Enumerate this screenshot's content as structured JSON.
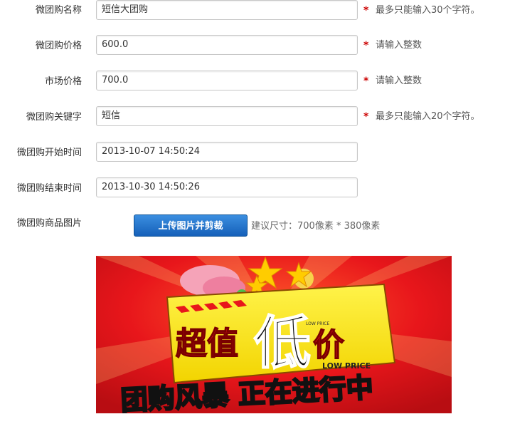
{
  "form": {
    "name": {
      "label": "微团购名称",
      "value": "短信大团购",
      "required": "*",
      "hint": "最多只能输入30个字符。"
    },
    "price": {
      "label": "微团购价格",
      "value": "600.0",
      "required": "*",
      "hint": "请输入整数"
    },
    "market_price": {
      "label": "市场价格",
      "value": "700.0",
      "required": "*",
      "hint": "请输入整数"
    },
    "keyword": {
      "label": "微团购关键字",
      "value": "短信",
      "required": "*",
      "hint": "最多只能输入20个字符。"
    },
    "start_time": {
      "label": "微团购开始时间",
      "value": "2013-10-07 14:50:24"
    },
    "end_time": {
      "label": "微团购结束时间",
      "value": "2013-10-30 14:50:26"
    },
    "image": {
      "label": "微团购商品图片",
      "upload_button": "上传图片并剪裁",
      "size_hint": "建议尺寸：700像素 * 380像素"
    }
  },
  "banner": {
    "title_left": "超值",
    "title_big": "低",
    "title_right": "价",
    "tag_small": "LOW PRICE",
    "tag_large": "LOW PRICE",
    "slogan": "团购风暴 正在进行中",
    "colors": {
      "background": "#e8161b",
      "panel": "#f7e900",
      "star": "#ffcc00"
    }
  }
}
